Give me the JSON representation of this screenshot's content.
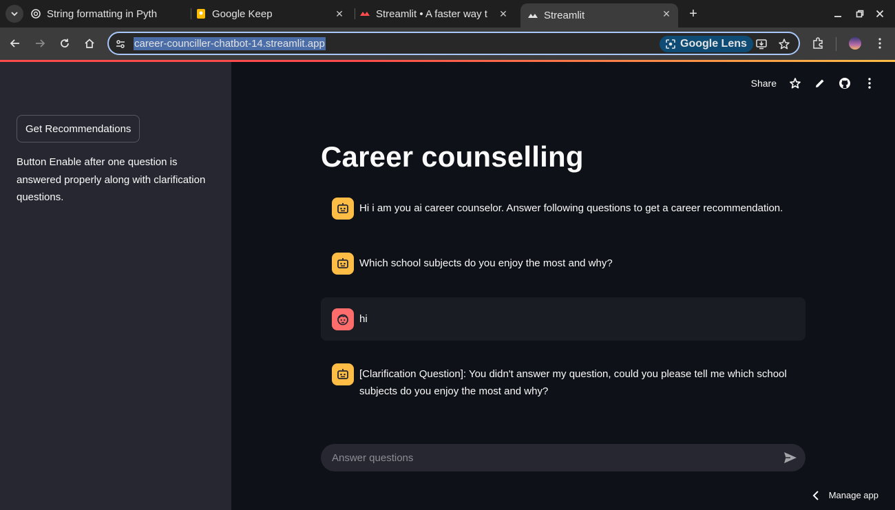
{
  "browser": {
    "tabs": [
      {
        "title": "String formatting in Pyth",
        "active": false
      },
      {
        "title": "Google Keep",
        "active": false
      },
      {
        "title": "Streamlit • A faster way t",
        "active": false
      },
      {
        "title": "Streamlit",
        "active": true
      }
    ],
    "url": "career-counciller-chatbot-14.streamlit.app",
    "lens_label": "Google Lens"
  },
  "sidebar": {
    "button_label": "Get Recommendations",
    "note": "Button Enable after one question is answered properly along with clarification questions."
  },
  "header": {
    "share_label": "Share"
  },
  "main": {
    "title": "Career counselling",
    "messages": [
      {
        "role": "assistant",
        "text": "Hi i am you ai career counselor. Answer following questions to get a career recommendation."
      },
      {
        "role": "assistant",
        "text": "Which school subjects do you enjoy the most and why?"
      },
      {
        "role": "user",
        "text": "hi"
      },
      {
        "role": "assistant",
        "text": "[Clarification Question]: You didn't answer my question, could you please tell me which school subjects do you enjoy the most and why?"
      }
    ],
    "input_placeholder": "Answer questions"
  },
  "footer": {
    "manage_label": "Manage app"
  },
  "colors": {
    "accent": "#ff4b4b",
    "bot_avatar": "#ffbd45",
    "user_avatar": "#ff6c6c",
    "sidebar_bg": "#262730",
    "main_bg": "#0e1117"
  }
}
